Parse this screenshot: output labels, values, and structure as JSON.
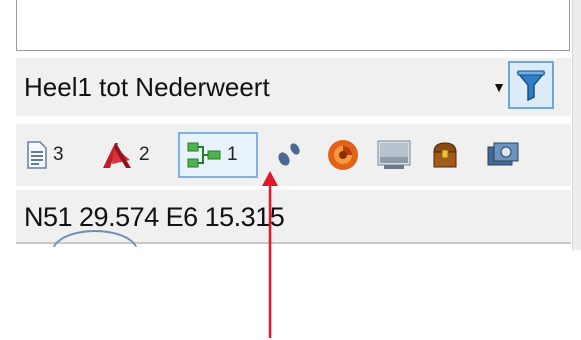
{
  "route_select": {
    "value": "Heel1 tot Nederweert"
  },
  "filter_button": {
    "icon": "funnel-filter-icon"
  },
  "toolbar": {
    "items": [
      {
        "name": "document",
        "icon": "document-list-icon",
        "count": "3"
      },
      {
        "name": "waypoints",
        "icon": "red-flag-waypoint-icon",
        "count": "2"
      },
      {
        "name": "routes",
        "icon": "green-route-icon",
        "count": "1"
      },
      {
        "name": "tracks",
        "icon": "footprints-icon",
        "count": ""
      },
      {
        "name": "geocache",
        "icon": "orange-sphere-icon",
        "count": ""
      },
      {
        "name": "map",
        "icon": "map-image-icon",
        "count": ""
      },
      {
        "name": "treasure",
        "icon": "treasure-chest-icon",
        "count": ""
      },
      {
        "name": "photos",
        "icon": "photo-camera-icon",
        "count": ""
      }
    ]
  },
  "status": {
    "coordinates": "N51 29.574 E6 15.315"
  },
  "colors": {
    "accent": "#6ea7d6",
    "annotation": "#e0182a"
  }
}
